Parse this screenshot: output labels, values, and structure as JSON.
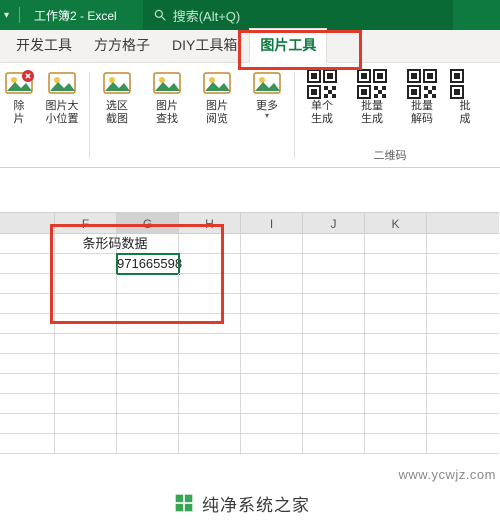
{
  "titlebar": {
    "doc_title": "工作簿2  -  Excel",
    "search_placeholder": "搜索(Alt+Q)"
  },
  "tabs": {
    "items": [
      {
        "label": "开发工具"
      },
      {
        "label": "方方格子"
      },
      {
        "label": "DIY工具箱"
      },
      {
        "label": "图片工具",
        "active": true
      }
    ]
  },
  "ribbon": {
    "group1": {
      "btn_delete_pic": "除\n片",
      "btn_pic_size": "图片大\n小位置"
    },
    "group2": {
      "btn_sel_capture": "选区\n截图",
      "btn_pic_find": "图片\n查找",
      "btn_pic_view": "图片\n阅览",
      "btn_more": "更多"
    },
    "group3": {
      "label": "二维码",
      "btn_single_gen": "单个\n生成",
      "btn_batch_gen": "批量\n生成",
      "btn_batch_decode": "批量\n解码",
      "btn_batch_make": "批\n成"
    }
  },
  "grid": {
    "columns": [
      "F",
      "G",
      "H",
      "I",
      "J",
      "K"
    ],
    "selected_col": "G",
    "header_cell": "条形码数据",
    "value_cell": "971665598"
  },
  "watermark": {
    "text": "www.ycwjz.com"
  },
  "brand": {
    "text": "纯净系统之家"
  }
}
